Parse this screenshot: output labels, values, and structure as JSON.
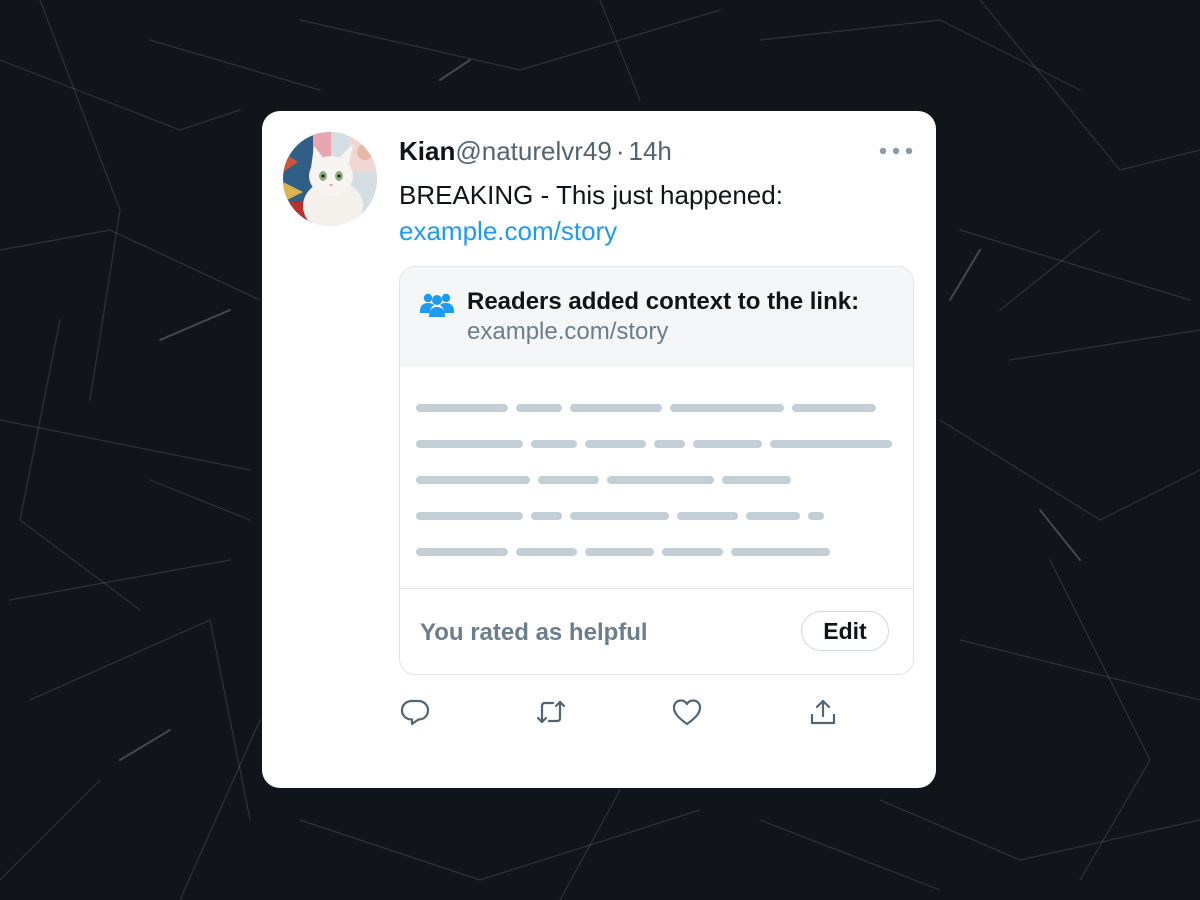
{
  "post": {
    "author_name": "Kian",
    "author_handle": "@naturelvr49",
    "separator": "·",
    "time": "14h",
    "text": "BREAKING - This just happened:",
    "link": "example.com/story",
    "avatar_description": "cat-avatar"
  },
  "community_note": {
    "title": "Readers added context to the link:",
    "link": "example.com/story",
    "icon": "people-icon",
    "rating_status": "You rated as helpful",
    "edit_label": "Edit",
    "placeholder_color": "#c3cfd6"
  },
  "actions": [
    {
      "name": "reply",
      "icon": "reply-icon"
    },
    {
      "name": "repost",
      "icon": "repost-icon"
    },
    {
      "name": "like",
      "icon": "heart-icon"
    },
    {
      "name": "share",
      "icon": "share-icon"
    }
  ],
  "colors": {
    "background": "#111519",
    "card": "#ffffff",
    "link": "#1d9bf0",
    "icon_accent": "#1d9bf0",
    "muted_text": "#536471"
  }
}
